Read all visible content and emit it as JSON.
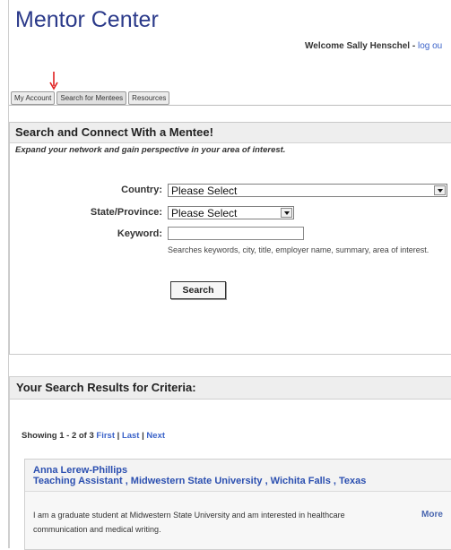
{
  "header": {
    "title": "Mentor Center",
    "welcome": "Welcome Sally Henschel",
    "logout_sep": " - ",
    "logout": "log ou"
  },
  "tabs": [
    {
      "label": "My Account"
    },
    {
      "label": "Search for Mentees"
    },
    {
      "label": "Resources"
    }
  ],
  "search": {
    "heading": "Search and Connect With a Mentee!",
    "subheading": "Expand your network and gain perspective in your area of interest.",
    "country_label": "Country:",
    "country_value": "Please Select",
    "state_label": "State/Province:",
    "state_value": "Please Select",
    "keyword_label": "Keyword:",
    "keyword_value": "",
    "hint": "Searches keywords, city, title, employer name, summary, area of interest.",
    "button": "Search"
  },
  "results": {
    "heading": "Your Search Results for Criteria:",
    "showing": "Showing 1 - 2 of 3",
    "first": "First",
    "sep1": " | ",
    "last": "Last",
    "sep2": " | ",
    "next": "Next",
    "items": [
      {
        "name": "Anna Lerew-Phillips",
        "role": "Teaching Assistant , Midwestern State University , Wichita Falls , Texas",
        "summary": "I am a graduate student at Midwestern State University and am interested in healthcare communication and medical writing.",
        "more": "More"
      }
    ]
  },
  "colors": {
    "accent": "#2b4fb0",
    "arrow": "#e02020"
  }
}
